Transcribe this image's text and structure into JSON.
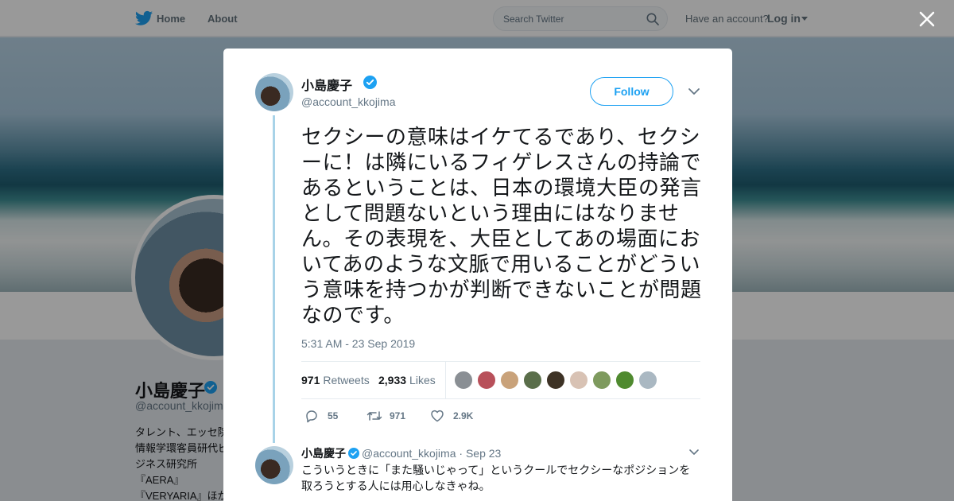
{
  "nav": {
    "home_label": "Home",
    "about_label": "About",
    "search_placeholder": "Search Twitter",
    "have_account": "Have an account?",
    "login_label": "Log in"
  },
  "background_profile": {
    "name": "小島慶子",
    "handle": "@account_kkojima",
    "bio": "タレント、エッセ院情報学環客員研代ビジネス研究所『AERA』『VERYARIA』ほか 新刊"
  },
  "tweet": {
    "author_name": "小島慶子",
    "author_handle": "@account_kkojima",
    "follow_label": "Follow",
    "text": "セクシーの意味はイケてるであり、セクシーに！は隣にいるフィゲレスさんの持論であるということは、日本の環境大臣の発言として問題ないという理由にはなりません。その表現を、大臣としてあの場面においてあのような文脈で用いることがどういう意味を持つかが判断できないことが問題なのです。",
    "timestamp": "5:31 AM - 23 Sep 2019",
    "retweets_count": "971",
    "retweets_label": "Retweets",
    "likes_count": "2,933",
    "likes_label": "Likes",
    "liker_colors": [
      "#8a8f94",
      "#b8505a",
      "#c9a27a",
      "#5a6e4a",
      "#3d3225",
      "#d8c2b4",
      "#7e9a5e",
      "#4f8a2f",
      "#aab8c2"
    ],
    "reply_count": "55",
    "retweet_count": "971",
    "like_count": "2.9K"
  },
  "reply": {
    "author_name": "小島慶子",
    "author_handle": "@account_kkojima",
    "date": "Sep 23",
    "text": "こういうときに「また騒いじゃって」というクールでセクシーなポジションを取ろうとする人には用心しなきゃね。"
  },
  "colors": {
    "brand_blue": "#1da1f2",
    "thread_line": "#a8d3e8",
    "muted_text": "#657786"
  }
}
